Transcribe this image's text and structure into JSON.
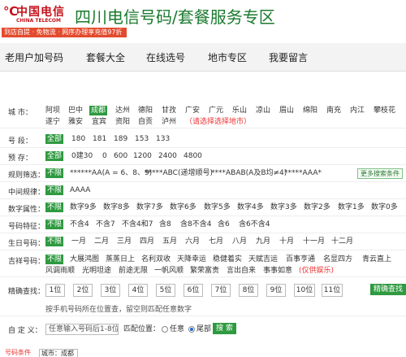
{
  "header": {
    "logo_mark": "℃",
    "logo_cn": "中国电信",
    "logo_en": "CHINA TELECOM",
    "site_title": "四川电信号码/套餐服务专区",
    "promo": "到店自提 · 免物流 · 网序办理享充值97折"
  },
  "nav": {
    "items": [
      "老用户加号码",
      "套餐大全",
      "在线选号",
      "地市专区",
      "我要留言"
    ]
  },
  "filters": {
    "city": {
      "label": "城 市：",
      "options_row1": [
        "阿坝",
        "巴中",
        "成都",
        "达州",
        "德阳",
        "甘孜",
        "广安",
        "广元",
        "乐山",
        "凉山",
        "眉山",
        "绵阳",
        "南充",
        "内江",
        "攀枝花"
      ],
      "options_row2": [
        "遂宁",
        "雅安",
        "宜宾",
        "资阳",
        "自贡",
        "泸州"
      ],
      "selected": "成都",
      "note": "（请选择选择地市）"
    },
    "segment": {
      "label": "号 段：",
      "all": "全部",
      "options": [
        "180",
        "181",
        "189",
        "153",
        "133"
      ]
    },
    "deposit": {
      "label": "预 存：",
      "all": "全部",
      "options": [
        "0建30",
        "0",
        "600",
        "1200",
        "2400",
        "4800"
      ]
    },
    "rule": {
      "label": "规则筛选：",
      "unlimited": "不限",
      "options": [
        "******AA(A = 6、8、9)",
        "*****ABC(递增顺号)",
        "****ABAB(A及B均≠4)",
        "*****AAA*"
      ],
      "more": "更多搜索条件"
    },
    "middle": {
      "label": "中间规律：",
      "unlimited": "不限",
      "options": [
        "AAAA"
      ]
    },
    "digit_attr": {
      "label": "数字属性：",
      "unlimited": "不限",
      "options": [
        "数字9多",
        "数字8多",
        "数字7多",
        "数字6多",
        "数字5多",
        "数字4多",
        "数字3多",
        "数字2多",
        "数字1多",
        "数字0多"
      ]
    },
    "number_feature": {
      "label": "号码特征：",
      "unlimited": "不限",
      "options": [
        "不含4",
        "不含7",
        "不含4和7",
        "含8",
        "含8不含4",
        "含6",
        "含6不含4"
      ]
    },
    "birthday": {
      "label": "生日号码：",
      "unlimited": "不限",
      "options": [
        "一月",
        "二月",
        "三月",
        "四月",
        "五月",
        "六月",
        "七月",
        "八月",
        "九月",
        "十月",
        "十一月",
        "十二月"
      ]
    },
    "lucky": {
      "label": "吉祥号码：",
      "unlimited": "不限",
      "options_row1": [
        "大展鸿图",
        "蒸蒸日上",
        "名利双收",
        "天降幸运",
        "稳健着实",
        "天赋吉运",
        "百事亨通",
        "名显四方",
        "青云直上"
      ],
      "options_row2": [
        "风调雨顺",
        "光明坦途",
        "前途无限",
        "一帆风顺",
        "繁荣富贵",
        "言出自来",
        "事事如意"
      ],
      "note": "(仅供娱乐)"
    },
    "precise": {
      "label": "精确查找：",
      "digits": [
        "1位",
        "2位",
        "3位",
        "4位",
        "5位",
        "6位",
        "7位",
        "8位",
        "9位",
        "10位",
        "11位"
      ],
      "button": "精确查找",
      "hint": "按手机号码所在位置查，留空则匹配任意数字"
    },
    "custom": {
      "label": "自 定 义：",
      "placeholder": "任意输入号码后1-8位",
      "match_label": "匹配位置：",
      "options": [
        "任意",
        "尾部"
      ],
      "selected": "尾部",
      "search": "搜 索"
    }
  },
  "sort": {
    "label": "号码条件",
    "select_value": "城市：成都"
  },
  "colors": {
    "brand_red": "#c5121b",
    "brand_green": "#1a7a2e",
    "selected_green": "#2f9a40",
    "promo_red": "#e34b2e"
  }
}
